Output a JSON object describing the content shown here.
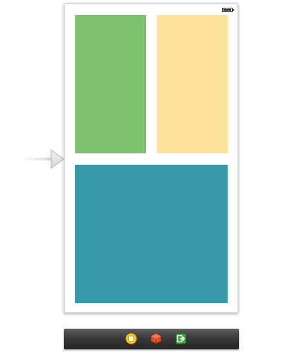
{
  "scene": {
    "status_bar": {
      "battery_icon": "battery-icon"
    },
    "views": [
      {
        "name": "green-view",
        "color": "#7cc26f"
      },
      {
        "name": "yellow-view",
        "color": "#fee19a"
      },
      {
        "name": "teal-view",
        "color": "#3698ab"
      }
    ]
  },
  "entry_point": {
    "icon": "initial-scene-arrow-icon"
  },
  "dock": {
    "items": [
      {
        "name": "view-controller-icon",
        "color": "#f5c518"
      },
      {
        "name": "first-responder-icon",
        "color": "#e0522b"
      },
      {
        "name": "exit-icon",
        "color": "#3cae3c"
      }
    ]
  },
  "colors": {
    "scene_border": "#c8c8c8",
    "dock_background": "#3a3a3a"
  }
}
